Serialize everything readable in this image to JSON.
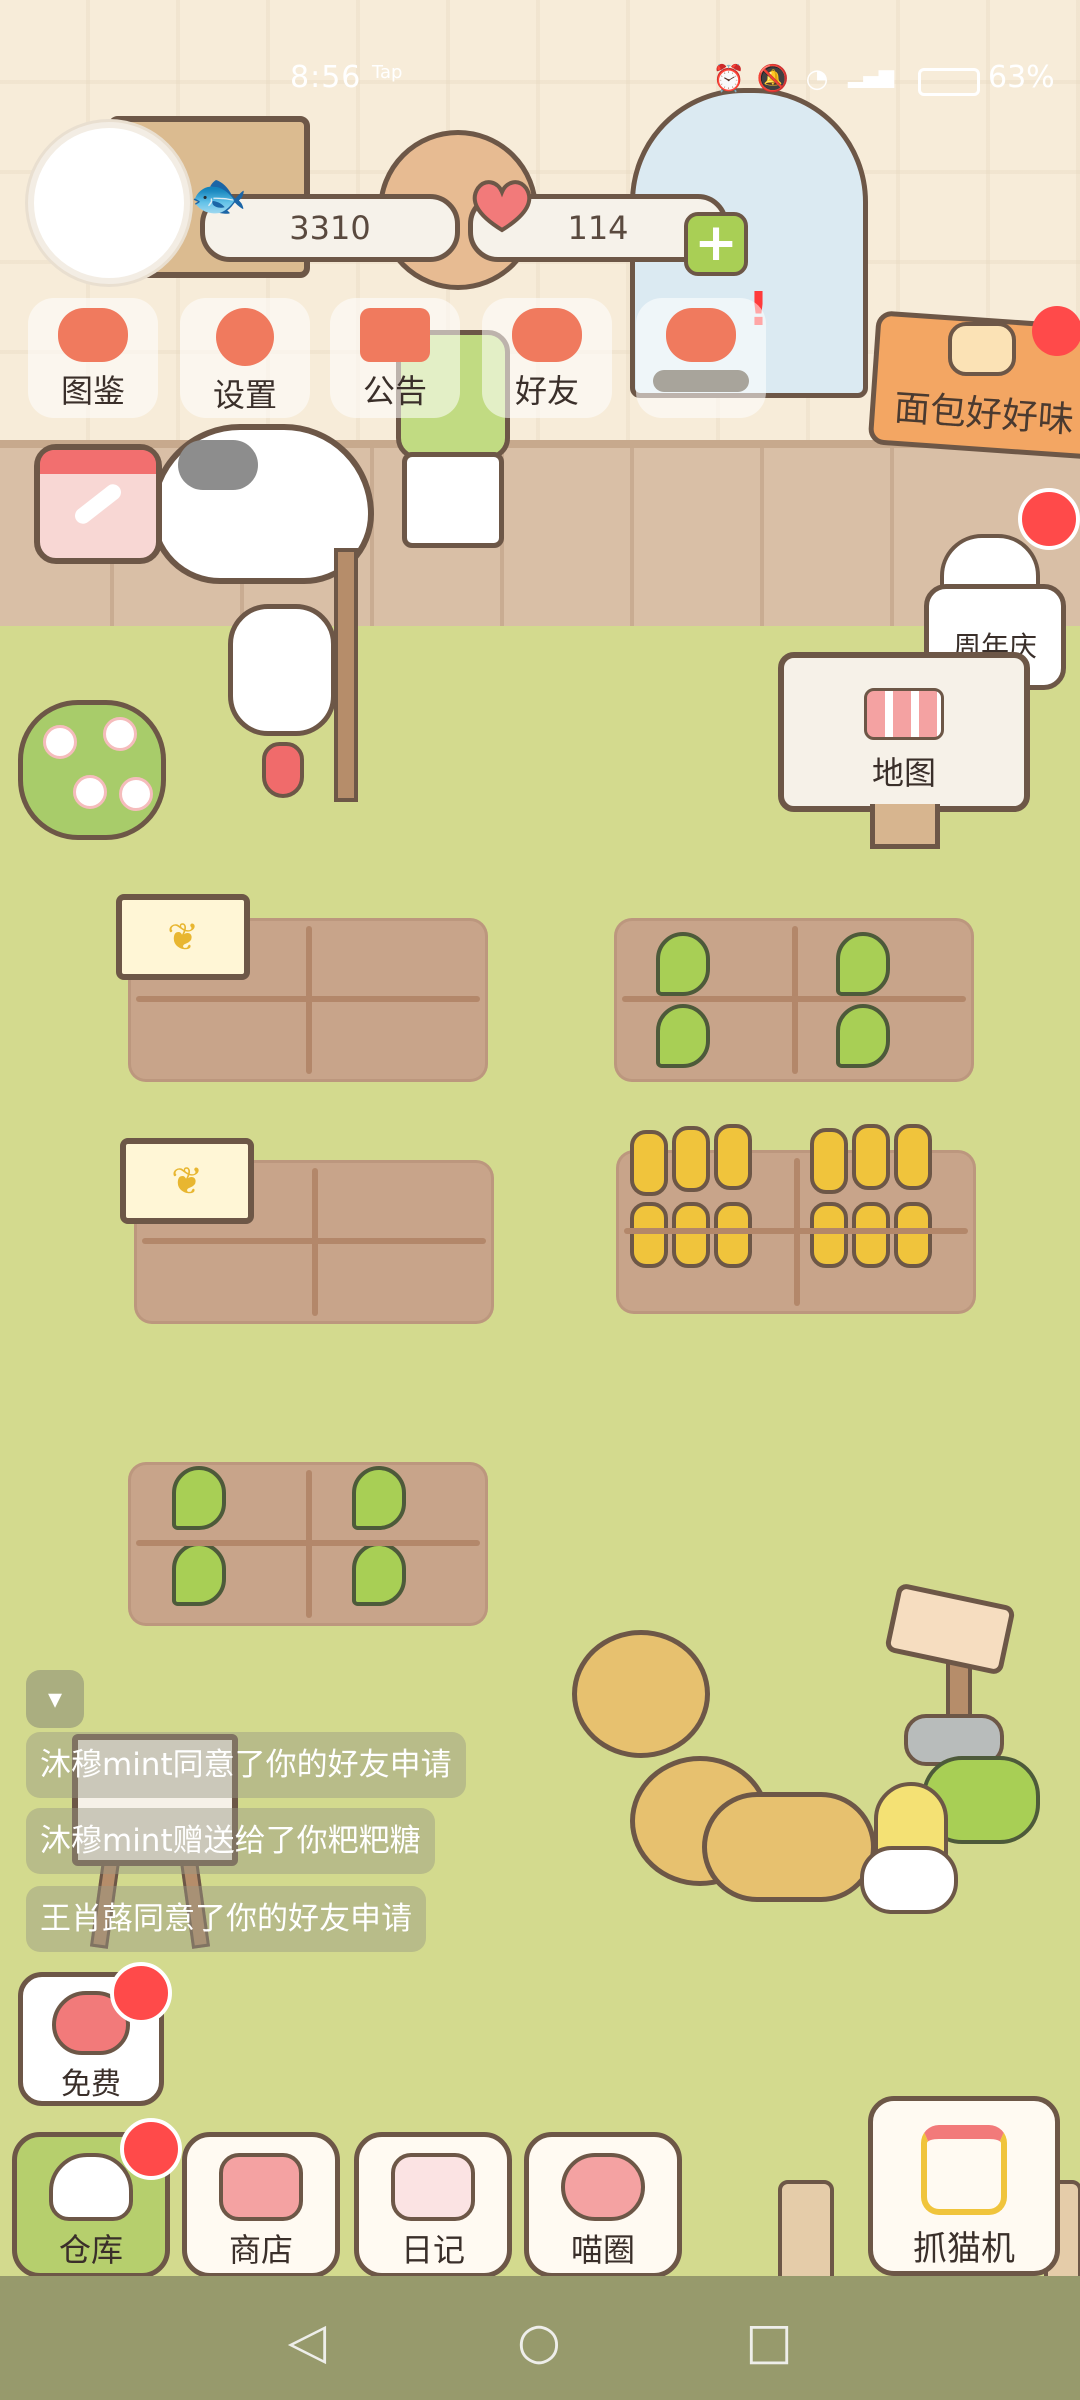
{
  "status_bar": {
    "time": "8:56",
    "time_sub": "Tap",
    "battery": "63%",
    "icons": [
      "alarm-icon",
      "mute-icon",
      "wifi-icon",
      "4g-signal-icon",
      "battery-icon"
    ]
  },
  "resources": {
    "fish_count": "3310",
    "heart_count": "114",
    "alert": "!"
  },
  "top_menu": {
    "tujian": "图鉴",
    "shezhi": "设置",
    "gonggao": "公告",
    "haoyou": "好友"
  },
  "banner": {
    "bread": "面包好好味"
  },
  "events": {
    "anniversary": "周年庆",
    "map": "地图"
  },
  "chat": [
    "沐穆mint同意了你的好友申请",
    "沐穆mint赠送给了你粑粑糖",
    "王肖蕗同意了你的好友申请"
  ],
  "free": {
    "label": "免费"
  },
  "bottom_nav": {
    "cangku": "仓库",
    "shangdian": "商店",
    "riji": "日记",
    "miaoquan": "喵圈",
    "zhuamaoji": "抓猫机"
  },
  "colors": {
    "grass": "#d3da8e",
    "wall": "#f7ecd9",
    "outline": "#6d5747",
    "accent_red": "#ff4a4a",
    "accent_green": "#a9cf55"
  }
}
